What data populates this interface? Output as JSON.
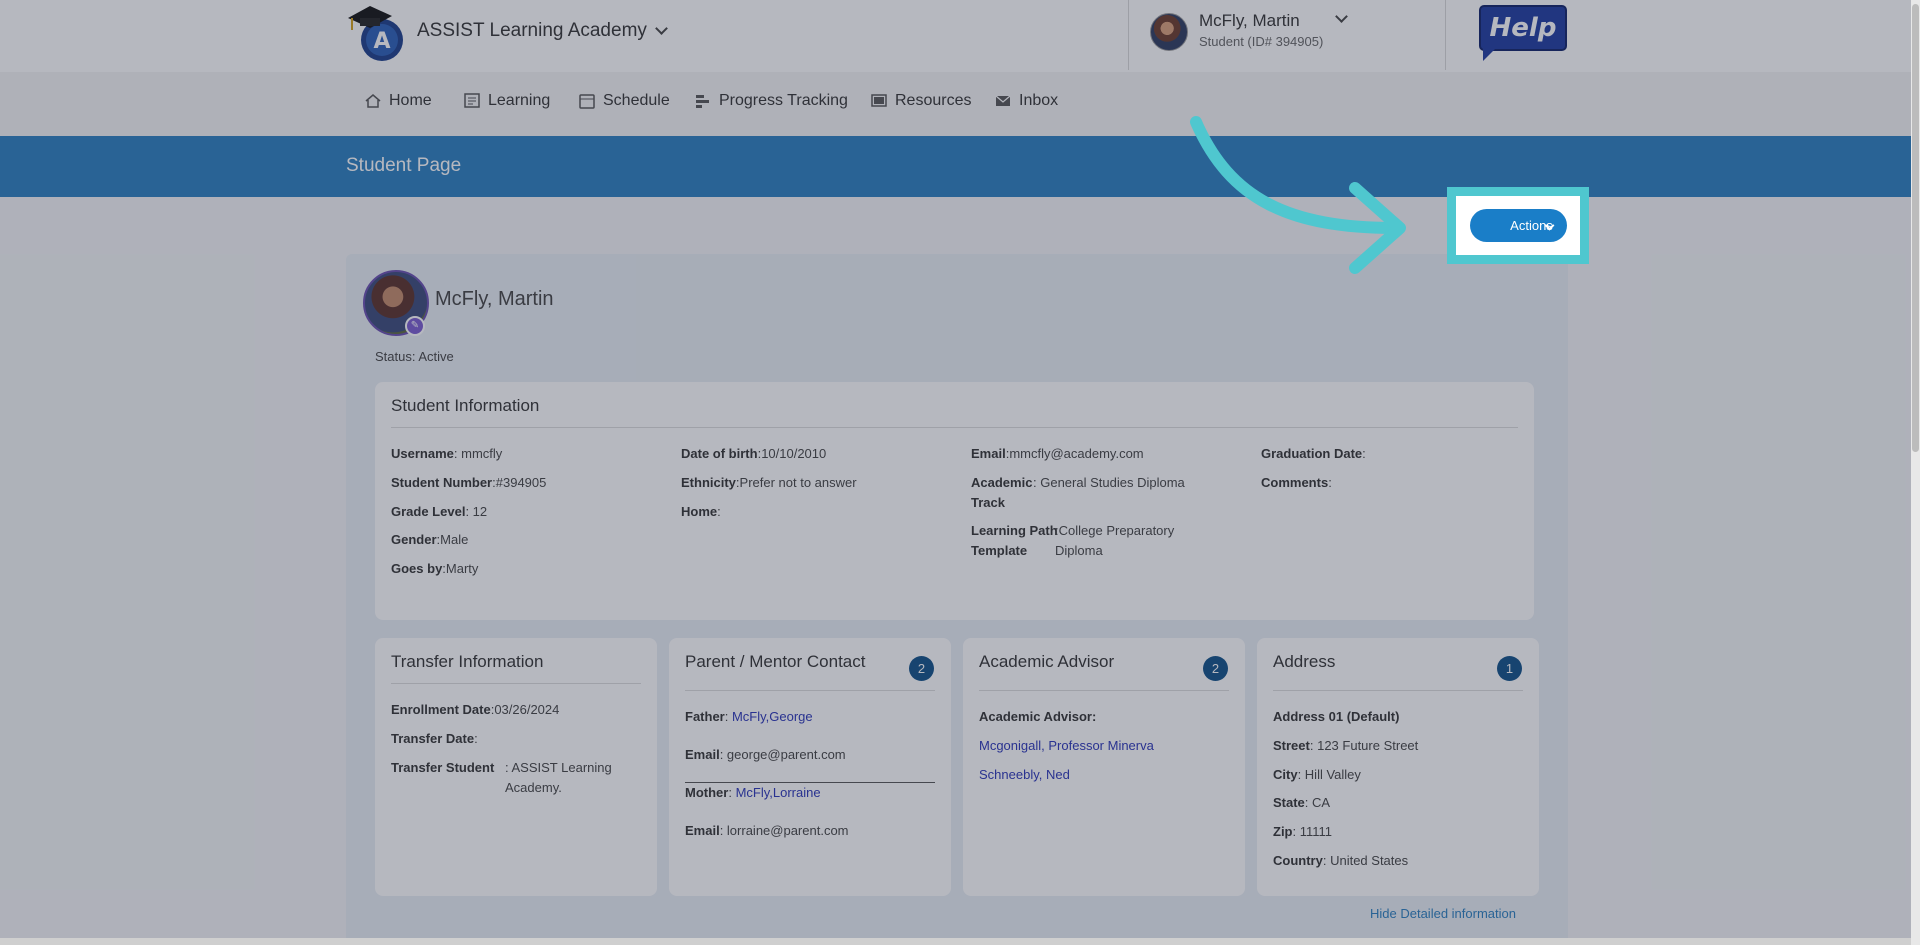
{
  "header": {
    "school_name": "ASSIST Learning Academy",
    "user_name": "McFly, Martin",
    "user_id": "Student (ID# 394905)",
    "help_label": "Help"
  },
  "nav": {
    "items": [
      {
        "label": "Home",
        "icon": "home-icon"
      },
      {
        "label": "Learning",
        "icon": "learning-icon"
      },
      {
        "label": "Schedule",
        "icon": "calendar-icon"
      },
      {
        "label": "Progress Tracking",
        "icon": "progress-icon"
      },
      {
        "label": "Resources",
        "icon": "resources-icon"
      },
      {
        "label": "Inbox",
        "icon": "mail-icon"
      }
    ]
  },
  "banner": {
    "title": "Student Page"
  },
  "actions": {
    "label": "Actions"
  },
  "profile": {
    "name": "McFly, Martin",
    "status": "Status: Active"
  },
  "student_info": {
    "title": "Student Information",
    "col1": [
      {
        "label": "Username",
        "sep": ": ",
        "value": "mmcfly"
      },
      {
        "label": "Student Number",
        "sep": ":",
        "value": "#394905"
      },
      {
        "label": "Grade Level",
        "sep": ": ",
        "value": "12"
      },
      {
        "label": "Gender",
        "sep": ":",
        "value": "Male"
      },
      {
        "label": "Goes by",
        "sep": ":",
        "value": "Marty"
      }
    ],
    "col2": [
      {
        "label": "Date of birth",
        "sep": ":",
        "value": "10/10/2010"
      },
      {
        "label": "Ethnicity",
        "sep": ":",
        "value": "Prefer not to answer"
      },
      {
        "label": "Home",
        "sep": ":",
        "value": ""
      }
    ],
    "email": {
      "label": "Email",
      "value": "mmcfly@academy.com"
    },
    "academic_track": {
      "label": "Academic Track",
      "value": "General Studies Diploma"
    },
    "learning_path": {
      "label": "Learning Path Template",
      "value": "College Preparatory Diploma"
    },
    "graduation": {
      "label": "Graduation Date",
      "value": ""
    },
    "comments": {
      "label": "Comments",
      "value": ""
    }
  },
  "transfer": {
    "title": "Transfer Information",
    "enrollment": {
      "label": "Enrollment Date",
      "value": "03/26/2024"
    },
    "transfer_date": {
      "label": "Transfer Date",
      "value": ""
    },
    "transfer_student": {
      "label": "Transfer Student",
      "value": "ASSIST Learning Academy."
    }
  },
  "parent": {
    "title": "Parent / Mentor Contact",
    "count": "2",
    "father": {
      "label": "Father",
      "value": "McFly,George"
    },
    "father_email": {
      "label": "Email",
      "value": "george@parent.com"
    },
    "mother": {
      "label": "Mother",
      "value": "McFly,Lorraine"
    },
    "mother_email": {
      "label": "Email",
      "value": "lorraine@parent.com"
    }
  },
  "advisor": {
    "title": "Academic Advisor",
    "count": "2",
    "label": "Academic Advisor:",
    "names": [
      "Mcgonigall, Professor Minerva",
      "Schneebly, Ned"
    ]
  },
  "address": {
    "title": "Address",
    "count": "1",
    "heading": "Address 01 (Default)",
    "street": {
      "label": "Street",
      "value": "123 Future Street"
    },
    "city": {
      "label": "City",
      "value": "Hill Valley"
    },
    "state": {
      "label": "State",
      "value": "CA"
    },
    "zip": {
      "label": "Zip",
      "value": "11111"
    },
    "country": {
      "label": "Country",
      "value": "United States"
    }
  },
  "hide_link": "Hide Detailed information",
  "colors": {
    "banner": "#2a7fc0",
    "highlight": "#4fc7cf",
    "action_button": "#1a7ec8",
    "link": "#2a35b8",
    "badge": "#0f4f87"
  }
}
